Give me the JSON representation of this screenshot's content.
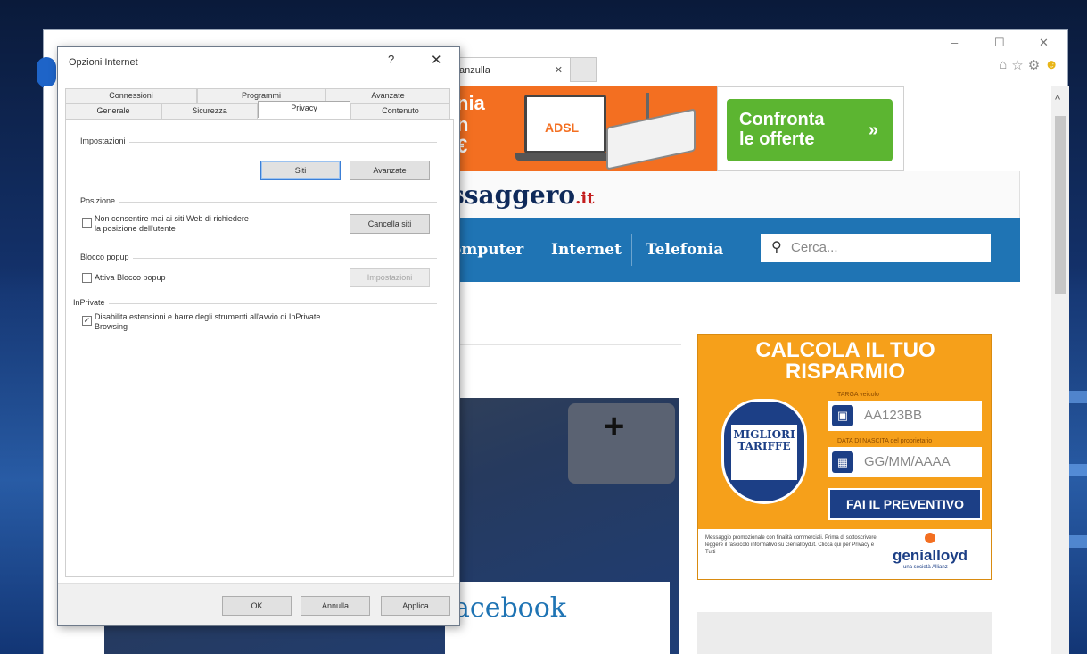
{
  "browser": {
    "window_controls": {
      "minimize": "–",
      "maximize": "☐",
      "close": "✕"
    },
    "toolbar_icons": [
      "⌂",
      "☆",
      "⚙",
      "☻"
    ],
    "tab": {
      "title": "anzulla",
      "close": "✕"
    }
  },
  "page": {
    "ad_adsl": {
      "fragment": "nia\nn\n€",
      "label": "ADSL"
    },
    "ad_compare": {
      "text": "Confronta\nle offerte",
      "arrow": "»"
    },
    "logo": {
      "text": "ssaggero",
      "suffix": ".it"
    },
    "nav": [
      "omputer",
      "Internet",
      "Telefonia"
    ],
    "search": {
      "icon": "🔍",
      "placeholder": "Cerca..."
    },
    "hero_caption": "acebook",
    "hero_key_glyph": "+",
    "ins_ad": {
      "title": "CALCOLA IL TUO\nRISPARMIO",
      "badge": "MIGLIORI\nTARIFFE",
      "plate_label": "TARGA veicolo",
      "plate_value": "AA123BB",
      "date_label": "DATA DI NASCITA del proprietario",
      "date_value": "GG/MM/AAAA",
      "cta": "FAI IL PREVENTIVO",
      "fine_print": "Messaggio promozionale con finalità commerciali. Prima di sottoscrivere leggere il fascicolo informativo su Genialloyd.it. Clicca qui per Privacy e Tutti",
      "brand": "genialloyd",
      "brand_sub": "una società Allianz"
    },
    "scroll_up": "^"
  },
  "dialog": {
    "title": "Opzioni Internet",
    "help": "?",
    "close": "✕",
    "tabs_row1": [
      "Connessioni",
      "Programmi",
      "Avanzate"
    ],
    "tabs_row2": [
      "Generale",
      "Sicurezza",
      "Privacy",
      "Contenuto"
    ],
    "active_tab": "Privacy",
    "sections": {
      "impostazioni": {
        "label": "Impostazioni",
        "btn_siti": "Siti",
        "btn_avanzate": "Avanzate"
      },
      "posizione": {
        "label": "Posizione",
        "checkbox": "Non consentire mai ai siti Web di richiedere\nla posizione dell'utente",
        "btn": "Cancella siti"
      },
      "popup": {
        "label": "Blocco popup",
        "checkbox": "Attiva Blocco popup",
        "btn": "Impostazioni"
      },
      "inprivate": {
        "label": "InPrivate",
        "checkbox": "Disabilita estensioni e barre degli strumenti all'avvio di InPrivate\nBrowsing"
      }
    },
    "footer": {
      "ok": "OK",
      "annulla": "Annulla",
      "applica": "Applica"
    }
  }
}
